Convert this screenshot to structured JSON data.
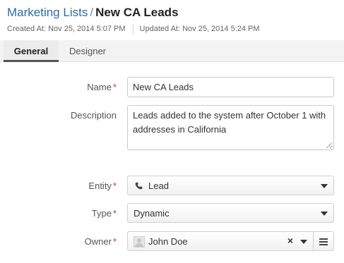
{
  "breadcrumb": {
    "parent": "Marketing Lists",
    "separator": "/",
    "title": "New CA Leads"
  },
  "meta": {
    "created": "Created At: Nov 25, 2014 5:07 PM",
    "updated": "Updated At: Nov 25, 2014 5:24 PM"
  },
  "tabs": [
    {
      "label": "General",
      "active": true
    },
    {
      "label": "Designer",
      "active": false
    }
  ],
  "form": {
    "required_marker": "*",
    "name": {
      "label": "Name",
      "value": "New CA Leads"
    },
    "description": {
      "label": "Description",
      "value": "Leads added to the system after October 1 with addresses in California"
    },
    "entity": {
      "label": "Entity",
      "value": "Lead",
      "icon": "phone-icon"
    },
    "type": {
      "label": "Type",
      "value": "Dynamic"
    },
    "owner": {
      "label": "Owner",
      "value": "John Doe"
    }
  },
  "colors": {
    "link": "#2c6aa8",
    "required": "#c0392b"
  }
}
